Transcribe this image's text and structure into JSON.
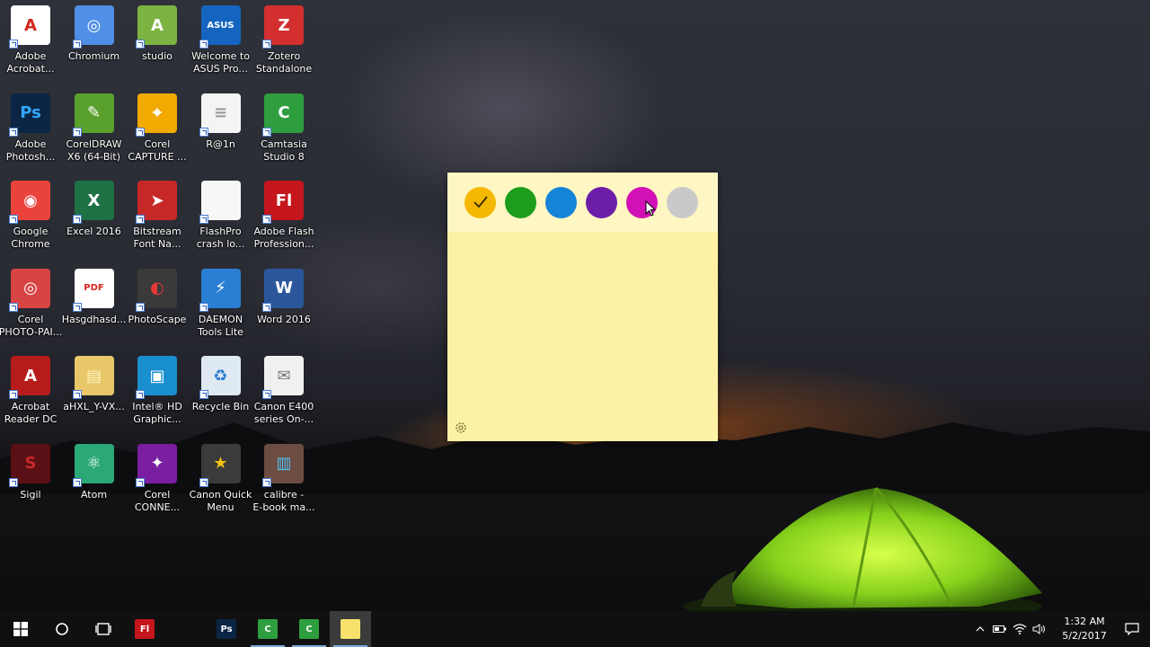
{
  "desktop": {
    "icons": [
      {
        "label": "Adobe\nAcrobat...",
        "icon": "adobe-acrobat-icon",
        "color": "#ffffff",
        "glyph": "A",
        "glyph_color": "#d5261d"
      },
      {
        "label": "Chromium",
        "icon": "chromium-icon",
        "color": "#4f8fe6",
        "glyph": "◎",
        "glyph_color": "#ffffff"
      },
      {
        "label": "studio",
        "icon": "android-studio-icon",
        "color": "#7cb342",
        "glyph": "A",
        "glyph_color": "#ffffff"
      },
      {
        "label": "Welcome to\nASUS Pro...",
        "icon": "asus-icon",
        "color": "#1565c0",
        "glyph": "ASUS",
        "glyph_color": "#ffffff"
      },
      {
        "label": "Zotero\nStandalone",
        "icon": "zotero-icon",
        "color": "#d32f2f",
        "glyph": "Z",
        "glyph_color": "#ffffff"
      },
      {
        "label": "Adobe\nPhotosh...",
        "icon": "photoshop-icon",
        "color": "#0b2545",
        "glyph": "Ps",
        "glyph_color": "#31a8ff"
      },
      {
        "label": "CorelDRAW\nX6 (64-Bit)",
        "icon": "coreldraw-icon",
        "color": "#5aa02c",
        "glyph": "✎",
        "glyph_color": "#ffffff"
      },
      {
        "label": "Corel\nCAPTURE ...",
        "icon": "corel-capture-icon",
        "color": "#f2a900",
        "glyph": "⌖",
        "glyph_color": "#ffffff"
      },
      {
        "label": "R@1n",
        "icon": "text-file-icon",
        "color": "#f4f4f4",
        "glyph": "≡",
        "glyph_color": "#9a9a9a"
      },
      {
        "label": "Camtasia\nStudio 8",
        "icon": "camtasia-icon",
        "color": "#2e9e3f",
        "glyph": "C",
        "glyph_color": "#ffffff"
      },
      {
        "label": "Google\nChrome",
        "icon": "chrome-icon",
        "color": "#e9433c",
        "glyph": "◉",
        "glyph_color": "#ffffff"
      },
      {
        "label": "Excel 2016",
        "icon": "excel-icon",
        "color": "#1e7145",
        "glyph": "X",
        "glyph_color": "#ffffff"
      },
      {
        "label": "Bitstream\nFont Na...",
        "icon": "bitstream-icon",
        "color": "#c62828",
        "glyph": "➤",
        "glyph_color": "#ffffff"
      },
      {
        "label": "FlashPro\ncrash lo...",
        "icon": "blank-file-icon",
        "color": "#f7f7f7",
        "glyph": "",
        "glyph_color": "#9a9a9a"
      },
      {
        "label": "Adobe Flash\nProfession...",
        "icon": "flash-icon",
        "color": "#c4161c",
        "glyph": "Fl",
        "glyph_color": "#ffffff"
      },
      {
        "label": "Corel\nPHOTO-PAI...",
        "icon": "corel-photopaint-icon",
        "color": "#d84343",
        "glyph": "◎",
        "glyph_color": "#ffffff"
      },
      {
        "label": "Hasgdhasd...",
        "icon": "pdf-file-icon",
        "color": "#ffffff",
        "glyph": "PDF",
        "glyph_color": "#d5261d"
      },
      {
        "label": "PhotoScape",
        "icon": "photoscape-icon",
        "color": "#3a3a3a",
        "glyph": "◐",
        "glyph_color": "#e53935"
      },
      {
        "label": "DAEMON\nTools Lite",
        "icon": "daemon-tools-icon",
        "color": "#2a7fd4",
        "glyph": "⚡",
        "glyph_color": "#ffffff"
      },
      {
        "label": "Word 2016",
        "icon": "word-icon",
        "color": "#2b579a",
        "glyph": "W",
        "glyph_color": "#ffffff"
      },
      {
        "label": "Acrobat\nReader DC",
        "icon": "acrobat-reader-icon",
        "color": "#b71c1c",
        "glyph": "A",
        "glyph_color": "#ffffff"
      },
      {
        "label": "aHXL_Y-VX...",
        "icon": "folder-icon",
        "color": "#e8c76a",
        "glyph": "▤",
        "glyph_color": "#fff3c0"
      },
      {
        "label": "Intel® HD\nGraphic...",
        "icon": "intel-graphics-icon",
        "color": "#1a8fd0",
        "glyph": "▣",
        "glyph_color": "#ffffff"
      },
      {
        "label": "Recycle Bin",
        "icon": "recycle-bin-icon",
        "color": "#dfe9f2",
        "glyph": "♻",
        "glyph_color": "#2b7bd0"
      },
      {
        "label": "Canon E400\nseries On-...",
        "icon": "canon-manual-icon",
        "color": "#f0f0f0",
        "glyph": "✉",
        "glyph_color": "#7a7a7a"
      },
      {
        "label": "Sigil",
        "icon": "sigil-icon",
        "color": "#5a1014",
        "glyph": "S",
        "glyph_color": "#c62828"
      },
      {
        "label": "Atom",
        "icon": "atom-icon",
        "color": "#2aa876",
        "glyph": "⚛",
        "glyph_color": "#ffffff"
      },
      {
        "label": "Corel\nCONNE...",
        "icon": "corel-connect-icon",
        "color": "#7b1fa2",
        "glyph": "✦",
        "glyph_color": "#ffffff"
      },
      {
        "label": "Canon Quick\nMenu",
        "icon": "canon-quick-menu-icon",
        "color": "#3b3b3b",
        "glyph": "★",
        "glyph_color": "#f4c20d"
      },
      {
        "label": "calibre -\nE-book ma...",
        "icon": "calibre-icon",
        "color": "#6d4c41",
        "glyph": "▥",
        "glyph_color": "#4fc3f7"
      }
    ]
  },
  "sticky_note": {
    "colors": [
      {
        "name": "yellow",
        "hex": "#f5b800",
        "selected": true
      },
      {
        "name": "green",
        "hex": "#1c9d1c"
      },
      {
        "name": "blue",
        "hex": "#1583d8"
      },
      {
        "name": "purple",
        "hex": "#6c1ea8"
      },
      {
        "name": "pink",
        "hex": "#d110b6"
      },
      {
        "name": "gray",
        "hex": "#c9c9c9"
      }
    ],
    "body_color": "#fdf1a6",
    "header_color": "#fef6c3"
  },
  "taskbar": {
    "apps": [
      {
        "icon": "flash-taskbar-icon",
        "color": "#c4161c",
        "glyph": "Fl",
        "running": false
      },
      {
        "icon": "photoshop-taskbar-icon",
        "color": "#0b2545",
        "glyph": "Ps",
        "running": false
      },
      {
        "icon": "camtasia-recorder-taskbar-icon",
        "color": "#2e9e3f",
        "glyph": "C",
        "running": true
      },
      {
        "icon": "camtasia-studio-taskbar-icon",
        "color": "#2e9e3f",
        "glyph": "C",
        "running": true
      },
      {
        "icon": "sticky-notes-taskbar-icon",
        "color": "#f7e26b",
        "glyph": "",
        "running": true,
        "active": true
      }
    ],
    "clock": {
      "time": "1:32 AM",
      "date": "5/2/2017"
    }
  }
}
